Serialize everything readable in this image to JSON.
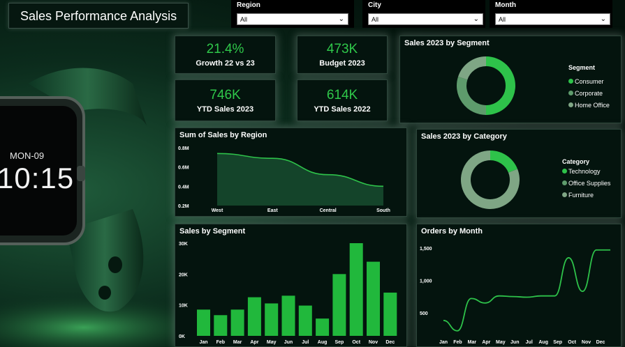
{
  "title": "Sales Performance Analysis",
  "filters": [
    {
      "label": "Region",
      "value": "All"
    },
    {
      "label": "City",
      "value": "All"
    },
    {
      "label": "Month",
      "value": "All"
    }
  ],
  "watch": {
    "date": "MON-09",
    "time": "10:15"
  },
  "kpis": [
    {
      "value": "21.4%",
      "label": "Growth 22 vs 23"
    },
    {
      "value": "473K",
      "label": "Budget 2023"
    },
    {
      "value": "746K",
      "label": "YTD Sales 2023"
    },
    {
      "value": "614K",
      "label": "YTD Sales 2022"
    }
  ],
  "colors": {
    "accent": "#2ec24a",
    "mid": "#5e9b6c",
    "light": "#7fa685",
    "panel": "#04140e"
  },
  "chart_data": [
    {
      "type": "pie",
      "variant": "donut",
      "title": "Sales 2023 by Segment",
      "legend_title": "Segment",
      "categories": [
        "Consumer",
        "Corporate",
        "Home Office"
      ],
      "values": [
        50,
        30,
        20
      ],
      "colors": [
        "#2ec24a",
        "#5e9b6c",
        "#7fa685"
      ],
      "legend": "right"
    },
    {
      "type": "area",
      "title": "Sum of Sales by Region",
      "categories": [
        "West",
        "East",
        "Central",
        "South"
      ],
      "values": [
        0.74,
        0.69,
        0.52,
        0.4
      ],
      "yticks": [
        "0.8M",
        "0.6M",
        "0.4M",
        "0.2M"
      ],
      "ylim": [
        0.2,
        0.8
      ],
      "grid": false
    },
    {
      "type": "pie",
      "variant": "donut",
      "title": "Sales 2023 by Category",
      "legend_title": "Category",
      "categories": [
        "Technology",
        "Office Supplies",
        "Furniture"
      ],
      "values": [
        19,
        0,
        81
      ],
      "colors": [
        "#2ec24a",
        "#5e9b6c",
        "#7fa685"
      ],
      "legend": "right"
    },
    {
      "type": "bar",
      "title": "Sales by Segment",
      "categories": [
        "Jan",
        "Feb",
        "Mar",
        "Apr",
        "May",
        "Jun",
        "Jul",
        "Aug",
        "Sep",
        "Oct",
        "Nov",
        "Dec"
      ],
      "values": [
        8500,
        6700,
        8500,
        12500,
        10500,
        13000,
        9800,
        5600,
        20000,
        30000,
        24000,
        14000
      ],
      "yticks": [
        "30K",
        "20K",
        "10K",
        "0K"
      ],
      "ylim": [
        0,
        30000
      ],
      "grid": false
    },
    {
      "type": "line",
      "title": "Orders by Month",
      "categories": [
        "Jan",
        "Feb",
        "Mar",
        "Apr",
        "May",
        "Jun",
        "Jul",
        "Aug",
        "Sep",
        "Oct",
        "Nov",
        "Dec"
      ],
      "values": [
        380,
        220,
        720,
        650,
        760,
        750,
        740,
        760,
        760,
        1350,
        830,
        1470,
        1470
      ],
      "yticks": [
        "1,500",
        "1,000",
        "500"
      ],
      "ylim": [
        250,
        1500
      ],
      "grid": false
    }
  ]
}
